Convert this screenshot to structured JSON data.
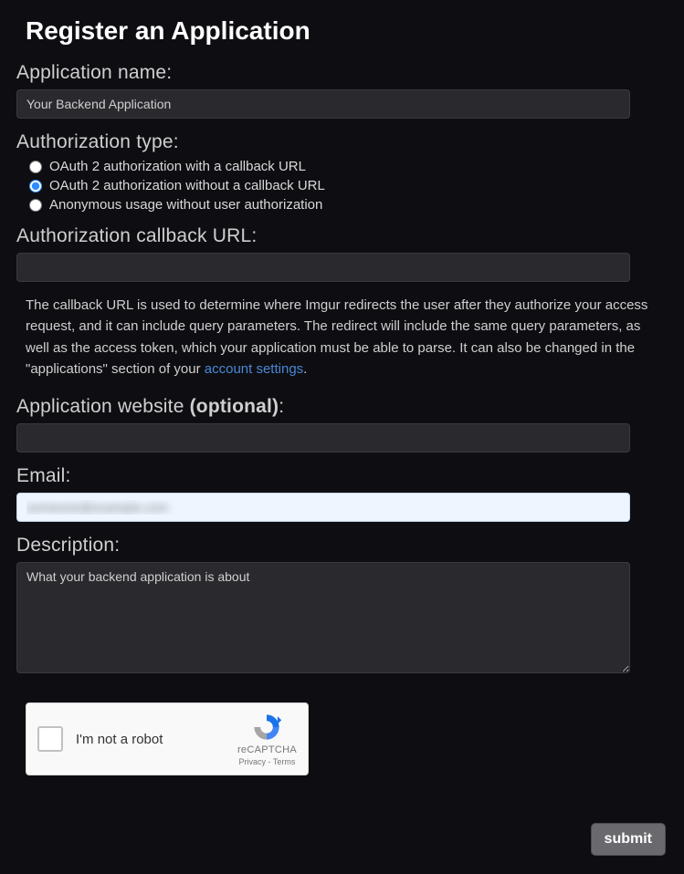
{
  "page_title": "Register an Application",
  "fields": {
    "app_name": {
      "label": "Application name:",
      "value": "Your Backend Application"
    },
    "auth_type": {
      "label": "Authorization type:",
      "options": {
        "with_callback": "OAuth 2 authorization with a callback URL",
        "without_callback": "OAuth 2 authorization without a callback URL",
        "anonymous": "Anonymous usage without user authorization"
      },
      "selected": "without_callback"
    },
    "callback_url": {
      "label": "Authorization callback URL:",
      "value": ""
    },
    "callback_help": {
      "text_before": "The callback URL is used to determine where Imgur redirects the user after they authorize your access request, and it can include query parameters. The redirect will include the same query parameters, as well as the access token, which your application must be able to parse. It can also be changed in the \"applications\" section of your ",
      "link_text": "account settings",
      "text_after": "."
    },
    "website": {
      "label_main": "Application website ",
      "label_optional": "(optional)",
      "label_suffix": ":",
      "value": ""
    },
    "email": {
      "label": "Email:",
      "value": "someone@example.com"
    },
    "description": {
      "label": "Description:",
      "value": "What your backend application is about"
    }
  },
  "captcha": {
    "label": "I'm not a robot",
    "brand": "reCAPTCHA",
    "legal": "Privacy - Terms"
  },
  "submit_label": "submit"
}
